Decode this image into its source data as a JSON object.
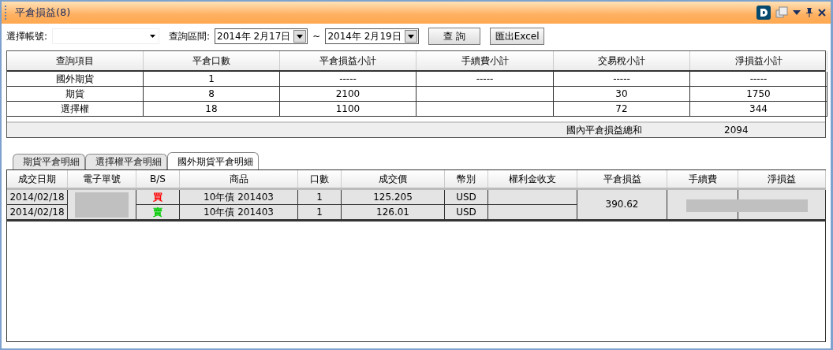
{
  "window": {
    "title": "平倉損益(8)"
  },
  "toolbar": {
    "account_label": "選擇帳號:",
    "range_label": "查詢區間:",
    "date_from": "2014年  2月17日",
    "range_sep": "~",
    "date_to": "2014年  2月19日",
    "query_button": "查 詢",
    "export_button": "匯出Excel"
  },
  "summary": {
    "columns": [
      "查詢項目",
      "平倉口數",
      "平倉損益小計",
      "手續費小計",
      "交易稅小計",
      "淨損益小計"
    ],
    "rows": [
      [
        "國外期貨",
        "1",
        "-----",
        "-----",
        "-----",
        "-----"
      ],
      [
        "期貨",
        "8",
        "2100",
        "",
        "30",
        "1750"
      ],
      [
        "選擇權",
        "18",
        "1100",
        "",
        "72",
        "344"
      ]
    ],
    "total_label": "國內平倉損益總和",
    "total_value": "2094"
  },
  "tabs": [
    {
      "label": "期貨平倉明細",
      "selected": false
    },
    {
      "label": "選擇權平倉明細",
      "selected": false
    },
    {
      "label": "國外期貨平倉明細",
      "selected": true
    }
  ],
  "detail": {
    "columns": [
      "成交日期",
      "電子單號",
      "B/S",
      "商品",
      "口數",
      "成交價",
      "幣別",
      "權利金收支",
      "平倉損益",
      "手續費",
      "淨損益"
    ],
    "rows": [
      {
        "date": "2014/02/18",
        "side": "買",
        "color": "#ff0000",
        "product": "10年債 201403",
        "qty": "1",
        "price": "125.205",
        "currency": "USD"
      },
      {
        "date": "2014/02/18",
        "side": "賣",
        "color": "#00cc00",
        "product": "10年債 201403",
        "qty": "1",
        "price": "126.01",
        "currency": "USD"
      }
    ],
    "pnl": "390.62"
  }
}
